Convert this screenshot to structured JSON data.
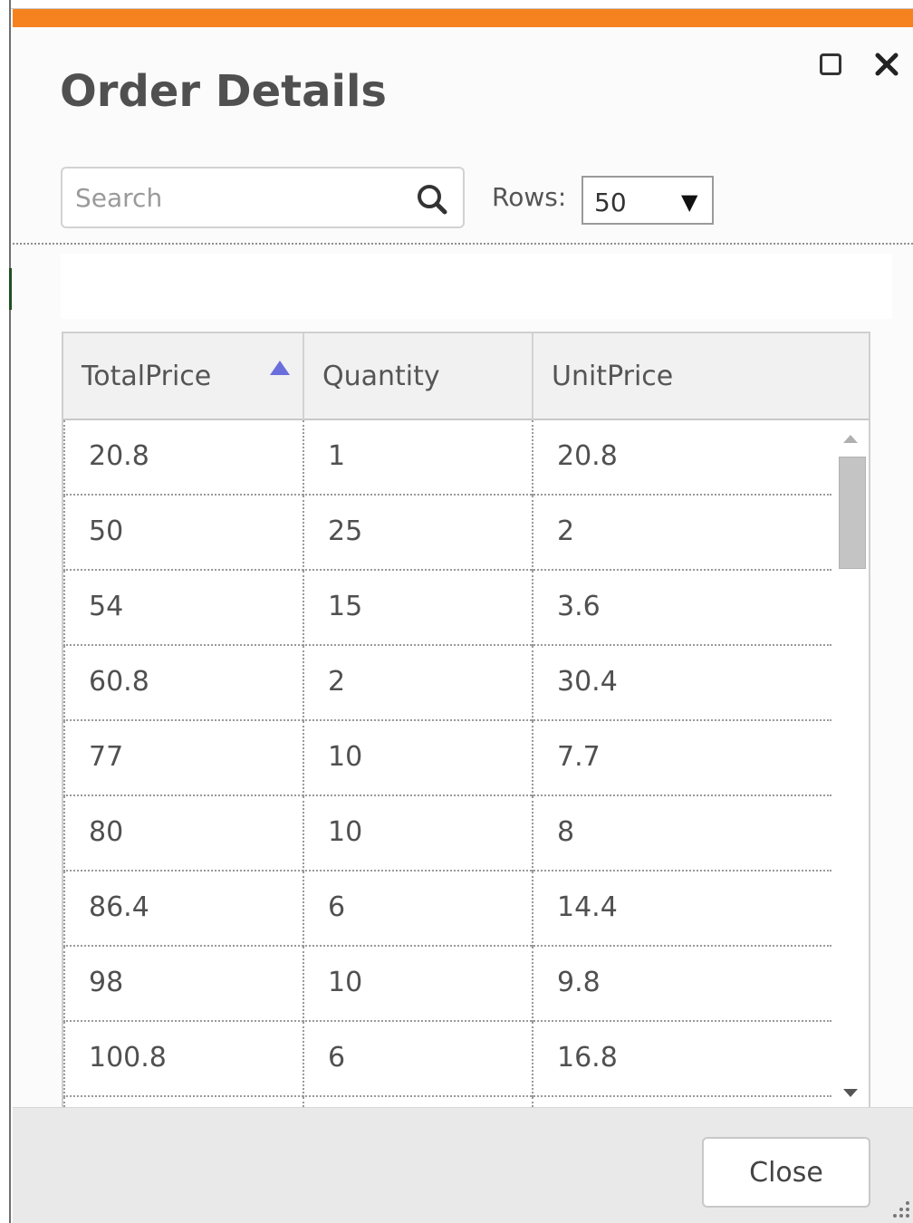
{
  "dialog": {
    "title": "Order Details"
  },
  "toolbar": {
    "search_placeholder": "Search",
    "rows_label": "Rows:",
    "rows_value": "50"
  },
  "table": {
    "columns": [
      "TotalPrice",
      "Quantity",
      "UnitPrice"
    ],
    "sort": {
      "column": "TotalPrice",
      "direction": "ascending"
    },
    "rows": [
      [
        "20.8",
        "1",
        "20.8"
      ],
      [
        "50",
        "25",
        "2"
      ],
      [
        "54",
        "15",
        "3.6"
      ],
      [
        "60.8",
        "2",
        "30.4"
      ],
      [
        "77",
        "10",
        "7.7"
      ],
      [
        "80",
        "10",
        "8"
      ],
      [
        "86.4",
        "6",
        "14.4"
      ],
      [
        "98",
        "10",
        "9.8"
      ],
      [
        "100.8",
        "6",
        "16.8"
      ]
    ]
  },
  "footer": {
    "close_label": "Close"
  },
  "colors": {
    "accent": "#f5821f",
    "sort_indicator": "#6b6fdc"
  }
}
